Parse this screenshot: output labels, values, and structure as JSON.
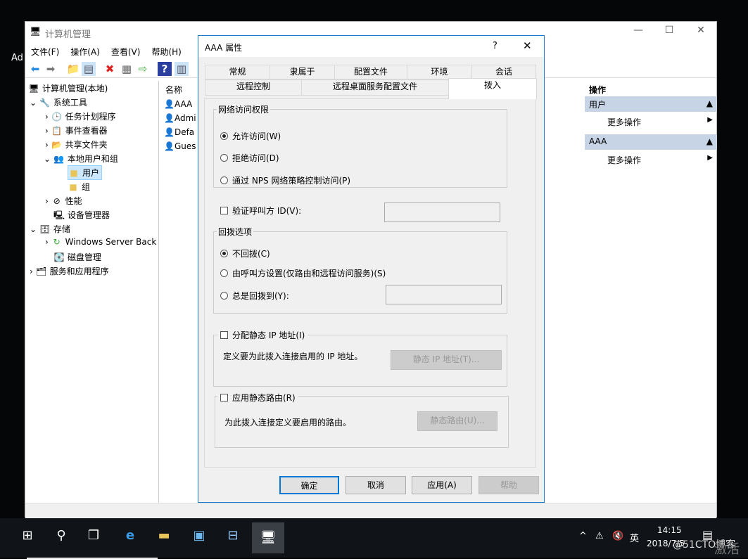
{
  "desktop": {
    "label": "Ad"
  },
  "mmc": {
    "title": "计算机管理",
    "menu": [
      "文件(F)",
      "操作(A)",
      "查看(V)",
      "帮助(H)"
    ],
    "tree": [
      {
        "label": "计算机管理(本地)",
        "icon": "computer-icon"
      },
      {
        "label": "系统工具",
        "icon": "tools-icon"
      },
      {
        "label": "任务计划程序",
        "icon": "clock-icon"
      },
      {
        "label": "事件查看器",
        "icon": "event-icon"
      },
      {
        "label": "共享文件夹",
        "icon": "share-icon"
      },
      {
        "label": "本地用户和组",
        "icon": "users-icon"
      },
      {
        "label": "用户",
        "icon": "folder-icon"
      },
      {
        "label": "组",
        "icon": "folder-icon"
      },
      {
        "label": "性能",
        "icon": "performance-icon"
      },
      {
        "label": "设备管理器",
        "icon": "device-icon"
      },
      {
        "label": "存储",
        "icon": "storage-icon"
      },
      {
        "label": "Windows Server Back",
        "icon": "backup-icon"
      },
      {
        "label": "磁盘管理",
        "icon": "disk-icon"
      },
      {
        "label": "服务和应用程序",
        "icon": "services-icon"
      }
    ],
    "list": {
      "header": "名称",
      "items": [
        "AAA",
        "Admi",
        "Defa",
        "Gues"
      ]
    },
    "actions": {
      "header": "操作",
      "groups": [
        {
          "title": "用户",
          "item": "更多操作"
        },
        {
          "title": "AAA",
          "item": "更多操作"
        }
      ]
    }
  },
  "dialog": {
    "title": "AAA 属性",
    "help": "?",
    "tabs_row1": [
      "常规",
      "隶属于",
      "配置文件",
      "环境",
      "会话"
    ],
    "tabs_row2": [
      "远程控制",
      "远程桌面服务配置文件",
      "拨入"
    ],
    "active_tab": "拨入",
    "network_access": {
      "legend": "网络访问权限",
      "options": [
        "允许访问(W)",
        "拒绝访问(D)",
        "通过 NPS 网络策略控制访问(P)"
      ],
      "selected": 0
    },
    "verify_caller": {
      "label": "验证呼叫方 ID(V):",
      "checked": false,
      "value": ""
    },
    "callback": {
      "legend": "回拨选项",
      "options": [
        "不回拨(C)",
        "由呼叫方设置(仅路由和远程访问服务)(S)",
        "总是回拨到(Y):"
      ],
      "selected": 0,
      "value": ""
    },
    "static_ip": {
      "label": "分配静态 IP 地址(I)",
      "checked": false,
      "desc": "定义要为此拨入连接启用的 IP 地址。",
      "button": "静态 IP 地址(T)..."
    },
    "static_route": {
      "label": "应用静态路由(R)",
      "checked": false,
      "desc": "为此拨入连接定义要启用的路由。",
      "button": "静态路由(U)..."
    },
    "buttons": {
      "ok": "确定",
      "cancel": "取消",
      "apply": "应用(A)",
      "help": "帮助"
    }
  },
  "taskbar": {
    "time": "14:15",
    "date": "2018/7/5",
    "ime": "英",
    "watermark": "@51CTO博客",
    "activate": "激活"
  }
}
